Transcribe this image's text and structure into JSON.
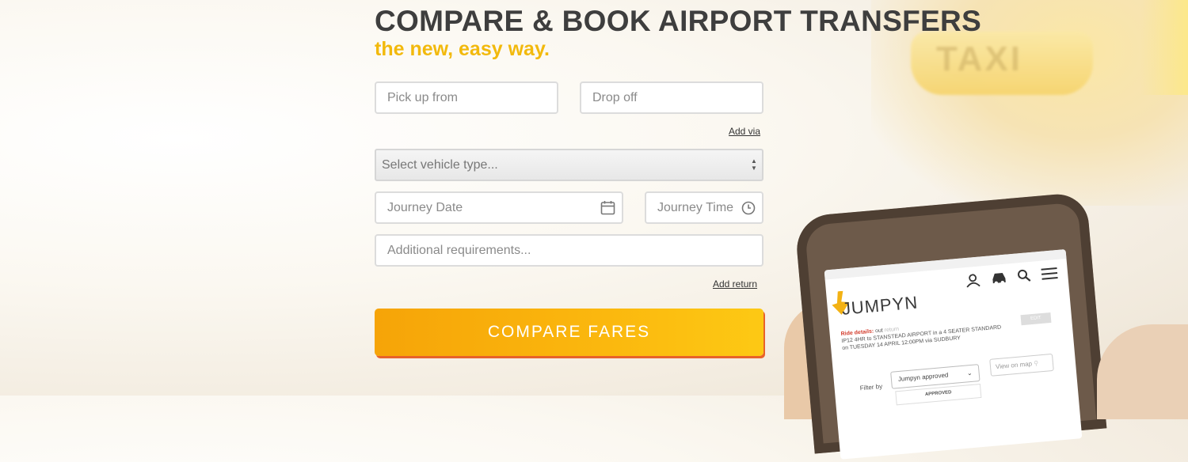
{
  "hero": {
    "title": "COMPARE & BOOK AIRPORT TRANSFERS",
    "subtitle": "the new, easy way."
  },
  "form": {
    "pickup_placeholder": "Pick up from",
    "dropoff_placeholder": "Drop off",
    "add_via": "Add via",
    "vehicle_select": "Select vehicle type...",
    "date_placeholder": "Journey Date",
    "time_placeholder": "Journey Time",
    "requirements_placeholder": "Additional requirements...",
    "add_return": "Add return",
    "submit_label": "COMPARE FARES"
  },
  "background": {
    "taxi_sign": "TAXI"
  },
  "phone_app": {
    "logo": "JUMPYN",
    "ride_details_label": "Ride details:",
    "ride_details_dir": "out",
    "ride_details_return": "return",
    "ride_details_line1": "IP12 4HR to STANSTEAD AIRPORT in a 4 SEATER STANDARD",
    "ride_details_line2": "on TUESDAY 14 APRIL 12:00PM via SUDBURY",
    "edit_label": "EDIT",
    "filter_label": "Filter by",
    "filter_value": "Jumpyn approved",
    "map_label": "View on map",
    "dropdown_option": "APPROVED"
  },
  "colors": {
    "accent_yellow": "#f2b90c",
    "cta_start": "#f6a408",
    "cta_end": "#fdc914",
    "cta_shadow": "#e8622a",
    "title": "#3e3e3e"
  }
}
